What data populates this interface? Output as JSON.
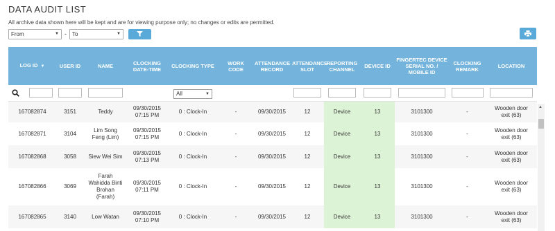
{
  "page": {
    "title": "DATA AUDIT LIST",
    "note": "All archive data shown here will be kept and are for viewing purpose only; no changes or edits are permitted."
  },
  "filters": {
    "from_label": "From",
    "separator": "-",
    "to_label": "To",
    "filter_icon": "filter-icon",
    "print_icon": "print-icon"
  },
  "table": {
    "columns": [
      "LOG ID",
      "USER ID",
      "NAME",
      "CLOCKING DATE-TIME",
      "CLOCKING TYPE",
      "WORK CODE",
      "ATTENDANCE RECORD",
      "ATTENDANCE SLOT",
      "REPORTING CHANNEL",
      "DEVICE ID",
      "FINGERTEC DEVICE SERIAL NO. / MOBILE ID",
      "CLOCKING REMARK",
      "LOCATION"
    ],
    "clocking_type_filter": "All",
    "rows": [
      {
        "log_id": "167082874",
        "user_id": "3151",
        "name": "Teddy",
        "datetime": "09/30/2015 07:15 PM",
        "type": "0 : Clock-In",
        "work_code": "-",
        "record": "09/30/2015",
        "slot": "12",
        "channel": "Device",
        "device_id": "13",
        "serial": "3101300",
        "remark": "-",
        "location": "Wooden door exit (63)"
      },
      {
        "log_id": "167082871",
        "user_id": "3104",
        "name": "Lim Song Feng (Lim)",
        "datetime": "09/30/2015 07:15 PM",
        "type": "0 : Clock-In",
        "work_code": "-",
        "record": "09/30/2015",
        "slot": "12",
        "channel": "Device",
        "device_id": "13",
        "serial": "3101300",
        "remark": "-",
        "location": "Wooden door exit (63)"
      },
      {
        "log_id": "167082868",
        "user_id": "3058",
        "name": "Siew Wei Sim",
        "datetime": "09/30/2015 07:13 PM",
        "type": "0 : Clock-In",
        "work_code": "-",
        "record": "09/30/2015",
        "slot": "12",
        "channel": "Device",
        "device_id": "13",
        "serial": "3101300",
        "remark": "-",
        "location": "Wooden door exit (63)"
      },
      {
        "log_id": "167082866",
        "user_id": "3069",
        "name": "Farah Wahidda Binti Brohan (Farah)",
        "datetime": "09/30/2015 07:11 PM",
        "type": "0 : Clock-In",
        "work_code": "-",
        "record": "09/30/2015",
        "slot": "12",
        "channel": "Device",
        "device_id": "13",
        "serial": "3101300",
        "remark": "-",
        "location": "Wooden door exit (63)"
      },
      {
        "log_id": "167082865",
        "user_id": "3140",
        "name": "Low Watan",
        "datetime": "09/30/2015 07:10 PM",
        "type": "0 : Clock-In",
        "work_code": "-",
        "record": "09/30/2015",
        "slot": "12",
        "channel": "Device",
        "device_id": "13",
        "serial": "3101300",
        "remark": "-",
        "location": "Wooden door exit (63)"
      }
    ]
  },
  "colors": {
    "header_bg": "#74b4dc",
    "button_bg": "#59a9d9",
    "channel_highlight": "#ddf3d6"
  }
}
